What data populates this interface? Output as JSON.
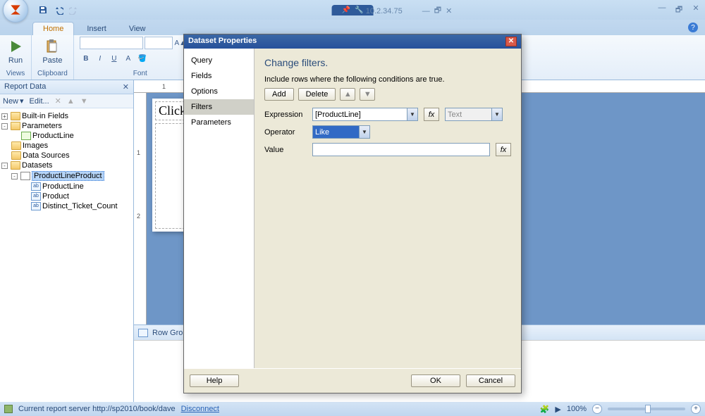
{
  "title_bar": {
    "host": "10.2.34.75"
  },
  "ribbon": {
    "tabs": [
      "Home",
      "Insert",
      "View"
    ],
    "active_tab": "Home",
    "groups": {
      "run": {
        "label": "Views",
        "btn": "Run"
      },
      "paste": {
        "label": "Clipboard",
        "btn": "Paste"
      },
      "font": {
        "label": "Font"
      }
    }
  },
  "report_data": {
    "title": "Report Data",
    "toolbar": {
      "new": "New",
      "edit": "Edit..."
    },
    "nodes": {
      "builtin": "Built-in Fields",
      "parameters": "Parameters",
      "productline_param": "ProductLine",
      "images": "Images",
      "datasources": "Data Sources",
      "datasets": "Datasets",
      "ds_name": "ProductLineProduct",
      "f1": "ProductLine",
      "f2": "Product",
      "f3": "Distinct_Ticket_Count"
    }
  },
  "design": {
    "title_placeholder": "Click",
    "row_groups": "Row Groups"
  },
  "statusbar": {
    "server_label": "Current report server http://sp2010/book/dave",
    "disconnect": "Disconnect",
    "zoom": "100%"
  },
  "dialog": {
    "title": "Dataset Properties",
    "nav": [
      "Query",
      "Fields",
      "Options",
      "Filters",
      "Parameters"
    ],
    "active_nav": "Filters",
    "heading": "Change filters.",
    "sub": "Include rows where the following conditions are true.",
    "btns": {
      "add": "Add",
      "delete": "Delete"
    },
    "labels": {
      "expression": "Expression",
      "operator": "Operator",
      "value": "Value"
    },
    "expression_value": "[ProductLine]",
    "type_placeholder": "Text",
    "operator_value": "Like",
    "fx": "fx",
    "help": "Help",
    "ok": "OK",
    "cancel": "Cancel"
  }
}
